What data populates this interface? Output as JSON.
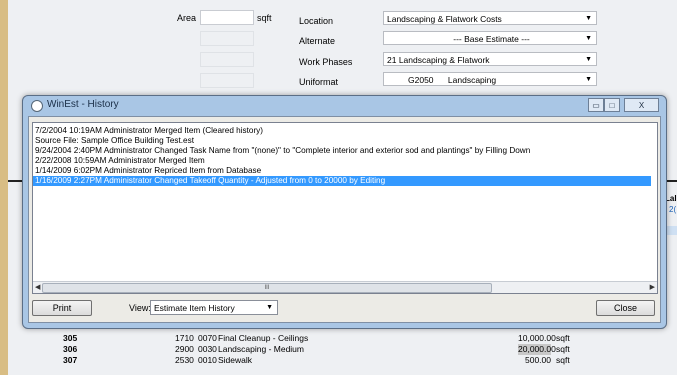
{
  "background_form": {
    "area_label": "Area",
    "area_unit": "sqft",
    "location_label": "Location",
    "location_value": "Landscaping & Flatwork Costs",
    "alternate_label": "Alternate",
    "alternate_value": "--- Base Estimate ---",
    "work_phases_label": "Work Phases",
    "work_phases_value": "21 Landscaping & Flatwork",
    "uniformat_label": "Uniformat",
    "uniformat_code": "G2050",
    "uniformat_name": "Landscaping",
    "right_stub_label": "Lal",
    "right_stub_value": "2("
  },
  "background_table": {
    "rows": [
      {
        "num": "305",
        "code": "1710",
        "sub": "0070",
        "desc": "Final Cleanup - Ceilings",
        "qty": "10,000.00",
        "unit": "sqft"
      },
      {
        "num": "306",
        "code": "2900",
        "sub": "0030",
        "desc": "Landscaping - Medium",
        "qty": "20,000.00",
        "unit": "sqft"
      },
      {
        "num": "307",
        "code": "2530",
        "sub": "0010",
        "desc": "Sidewalk",
        "qty": "500.00",
        "unit": "sqft"
      }
    ]
  },
  "dialog": {
    "title": "WinEst - History",
    "entries": [
      "7/2/2004 10:19AM Administrator Merged Item (Cleared history)",
      "Source File: Sample Office Building Test.est",
      "9/24/2004 2:40PM Administrator Changed Task Name from \"(none)\" to \"Complete interior and exterior sod and plantings\" by Filling Down",
      "2/22/2008 10:59AM Administrator Merged Item",
      "1/14/2009 6:02PM Administrator Repriced Item from Database",
      "1/16/2009 2:27PM Administrator Changed Takeoff Quantity - Adjusted from 0 to 20000 by Editing"
    ],
    "selected_index": 5,
    "scroll_grip": "III",
    "print_label": "Print",
    "view_label": "View:",
    "view_value": "Estimate Item History",
    "close_label": "Close",
    "minimize_glyph": "▭",
    "maximize_glyph": "□",
    "close_glyph": "X"
  },
  "colors": {
    "selection": "#3399ff",
    "desktop": "#d8bd84",
    "dialog_frame": "#a9c6e5"
  }
}
